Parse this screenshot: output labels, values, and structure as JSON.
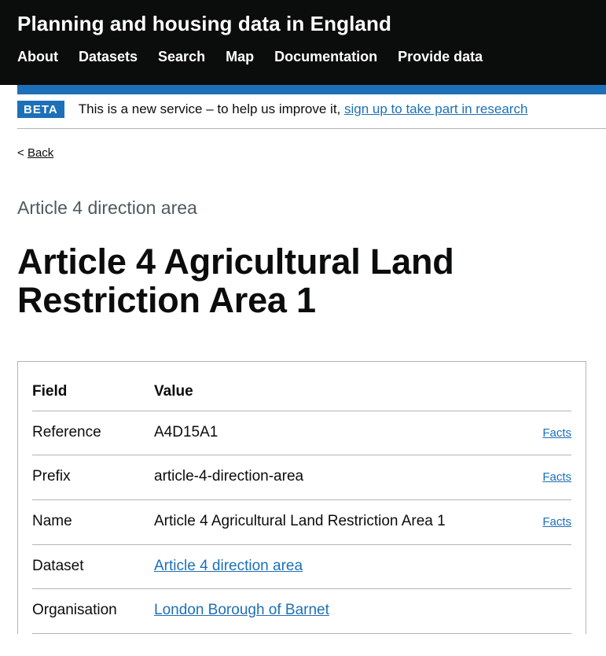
{
  "header": {
    "site_title": "Planning and housing data in England",
    "nav": [
      {
        "label": "About"
      },
      {
        "label": "Datasets"
      },
      {
        "label": "Search"
      },
      {
        "label": "Map"
      },
      {
        "label": "Documentation"
      },
      {
        "label": "Provide data"
      }
    ],
    "accent_color": "#1d70b8",
    "background_color": "#0b0c0c"
  },
  "phase_banner": {
    "tag": "BETA",
    "text_before": "This is a new service – to help us improve it,",
    "link_text": "sign up to take part in research"
  },
  "back_link": {
    "chevron": "<",
    "label": "Back"
  },
  "page": {
    "caption": "Article 4 direction area",
    "title": "Article 4 Agricultural Land Restriction Area 1"
  },
  "entity_table": {
    "columns": {
      "field": "Field",
      "value": "Value",
      "actions": ""
    },
    "rows": [
      {
        "field": "Reference",
        "value": "A4D15A1",
        "value_is_link": false,
        "action": "Facts"
      },
      {
        "field": "Prefix",
        "value": "article-4-direction-area",
        "value_is_link": false,
        "action": "Facts"
      },
      {
        "field": "Name",
        "value": "Article 4 Agricultural Land Restriction Area 1",
        "value_is_link": false,
        "action": "Facts"
      },
      {
        "field": "Dataset",
        "value": "Article 4 direction area",
        "value_is_link": true,
        "action": ""
      },
      {
        "field": "Organisation",
        "value": "London Borough of Barnet",
        "value_is_link": true,
        "action": ""
      }
    ]
  },
  "colors": {
    "link": "#1d70b8",
    "text": "#0b0c0c",
    "secondary_text": "#505a5f",
    "border": "#b1b4b6"
  }
}
